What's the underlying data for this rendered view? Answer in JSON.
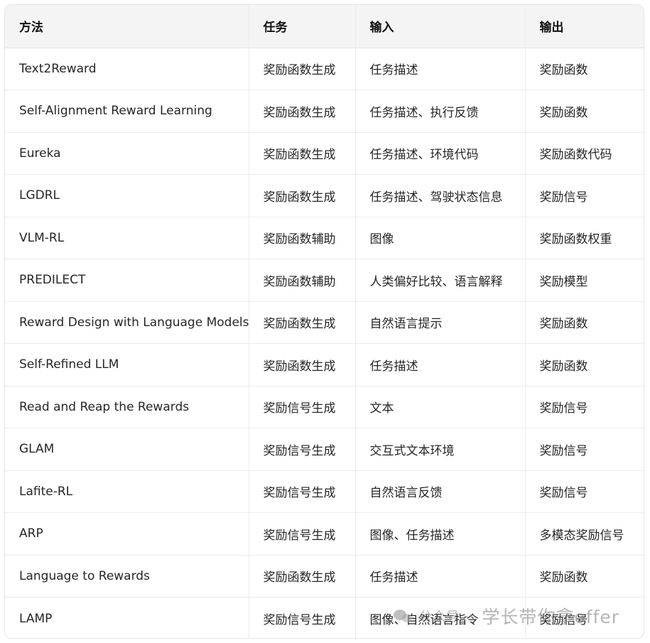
{
  "table": {
    "headers": [
      "方法",
      "任务",
      "输入",
      "输出"
    ],
    "rows": [
      [
        "Text2Reward",
        "奖励函数生成",
        "任务描述",
        "奖励函数"
      ],
      [
        "Self-Alignment Reward Learning",
        "奖励函数生成",
        "任务描述、执行反馈",
        "奖励函数"
      ],
      [
        "Eureka",
        "奖励函数生成",
        "任务描述、环境代码",
        "奖励函数代码"
      ],
      [
        "LGDRL",
        "奖励函数生成",
        "任务描述、驾驶状态信息",
        "奖励信号"
      ],
      [
        "VLM-RL",
        "奖励函数辅助",
        "图像",
        "奖励函数权重"
      ],
      [
        "PREDILECT",
        "奖励函数辅助",
        "人类偏好比较、语言解释",
        "奖励模型"
      ],
      [
        "Reward Design with Language Models",
        "奖励函数生成",
        "自然语言提示",
        "奖励函数"
      ],
      [
        "Self-Refined LLM",
        "奖励函数生成",
        "任务描述",
        "奖励函数"
      ],
      [
        "Read and Reap the Rewards",
        "奖励信号生成",
        "文本",
        "奖励信号"
      ],
      [
        "GLAM",
        "奖励信号生成",
        "交互式文本环境",
        "奖励信号"
      ],
      [
        "Lafite-RL",
        "奖励信号生成",
        "自然语言反馈",
        "奖励信号"
      ],
      [
        "ARP",
        "奖励信号生成",
        "图像、任务描述",
        "多模态奖励信号"
      ],
      [
        "Language to Rewards",
        "奖励函数生成",
        "任务描述",
        "奖励函数"
      ],
      [
        "LAMP",
        "奖励信号生成",
        "图像、自然语言指令",
        "奖励信号"
      ]
    ]
  },
  "watermark": {
    "icon": "wechat-icon",
    "prefix": "公众号 ·",
    "name": "学长带你拿offer"
  }
}
